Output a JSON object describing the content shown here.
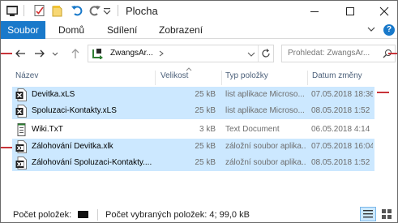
{
  "window": {
    "title": "Plocha"
  },
  "ribbon": {
    "file_tab": "Soubor",
    "tabs": [
      "Domů",
      "Sdílení",
      "Zobrazení"
    ],
    "help": "?"
  },
  "address": {
    "path": "ZwangsAr...",
    "search_placeholder": "Prohledat: ZwangsAr..."
  },
  "columns": {
    "name": "Název",
    "size": "Velikost",
    "type": "Typ položky",
    "date": "Datum změny"
  },
  "files": [
    {
      "name": "Devitka.xLS",
      "size": "25 kB",
      "type": "list aplikace Microso...",
      "date": "07.05.2018 18:36",
      "selected": true,
      "icon": "excel-icon"
    },
    {
      "name": "Spoluzaci-Kontakty.xLS",
      "size": "25 kB",
      "type": "list aplikace Microso...",
      "date": "08.05.2018 1:52",
      "selected": true,
      "icon": "excel-icon"
    },
    {
      "name": "Wiki.TxT",
      "size": "3 kB",
      "type": "Text Document",
      "date": "06.05.2018 4:14",
      "selected": false,
      "icon": "text-file-icon"
    },
    {
      "name": "Zálohování Devitka.xlk",
      "size": "25 kB",
      "type": "záložní soubor aplika...",
      "date": "07.05.2018 16:04",
      "selected": true,
      "icon": "excel-backup-icon"
    },
    {
      "name": "Zálohování Spoluzaci-Kontakty....",
      "size": "25 kB",
      "type": "záložní soubor aplika...",
      "date": "08.05.2018 1:52",
      "selected": true,
      "icon": "excel-backup-icon"
    }
  ],
  "status": {
    "count_label": "Počet položek:",
    "selected_label": "Počet vybraných položek: 4; 99,0 kB"
  },
  "colors": {
    "accent": "#1979ca",
    "selection": "#cce8ff",
    "marker": "#c8343a"
  }
}
